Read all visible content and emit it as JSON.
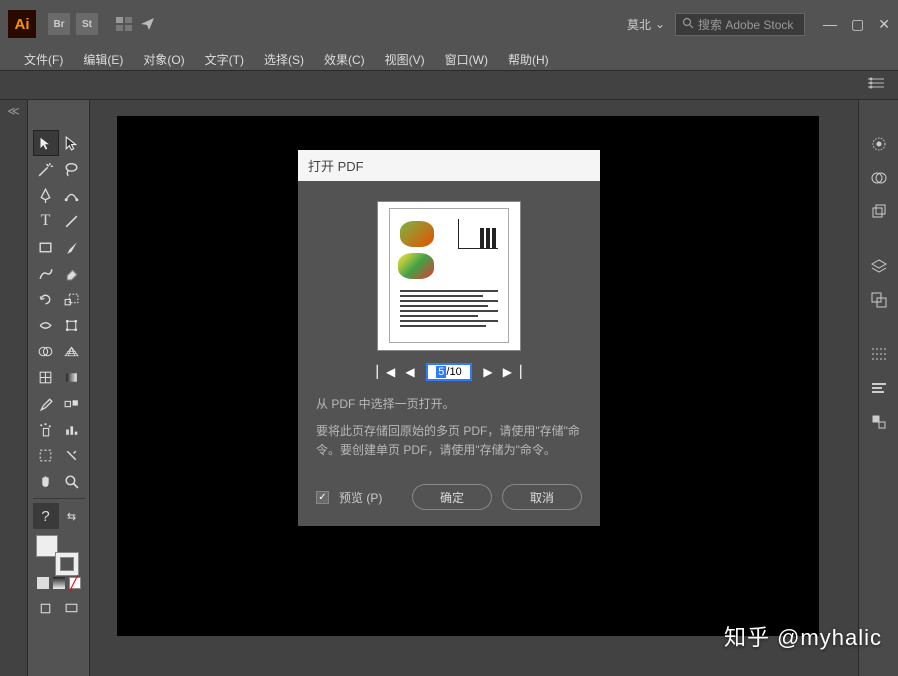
{
  "titlebar": {
    "essentials_label": "莫北",
    "search_placeholder": "搜索 Adobe Stock"
  },
  "menubar": {
    "items": [
      "文件(F)",
      "编辑(E)",
      "对象(O)",
      "文字(T)",
      "选择(S)",
      "效果(C)",
      "视图(V)",
      "窗口(W)",
      "帮助(H)"
    ]
  },
  "dialog": {
    "title": "打开 PDF",
    "page_current": "5",
    "page_total": "/10",
    "instruction": "从 PDF 中选择一页打开。",
    "hint": "要将此页存储回原始的多页 PDF，请使用\"存储\"命令。要创建单页 PDF，请使用\"存储为\"命令。",
    "preview_label": "预览 (P)",
    "ok": "确定",
    "cancel": "取消"
  },
  "watermark": "知乎 @myhalic"
}
